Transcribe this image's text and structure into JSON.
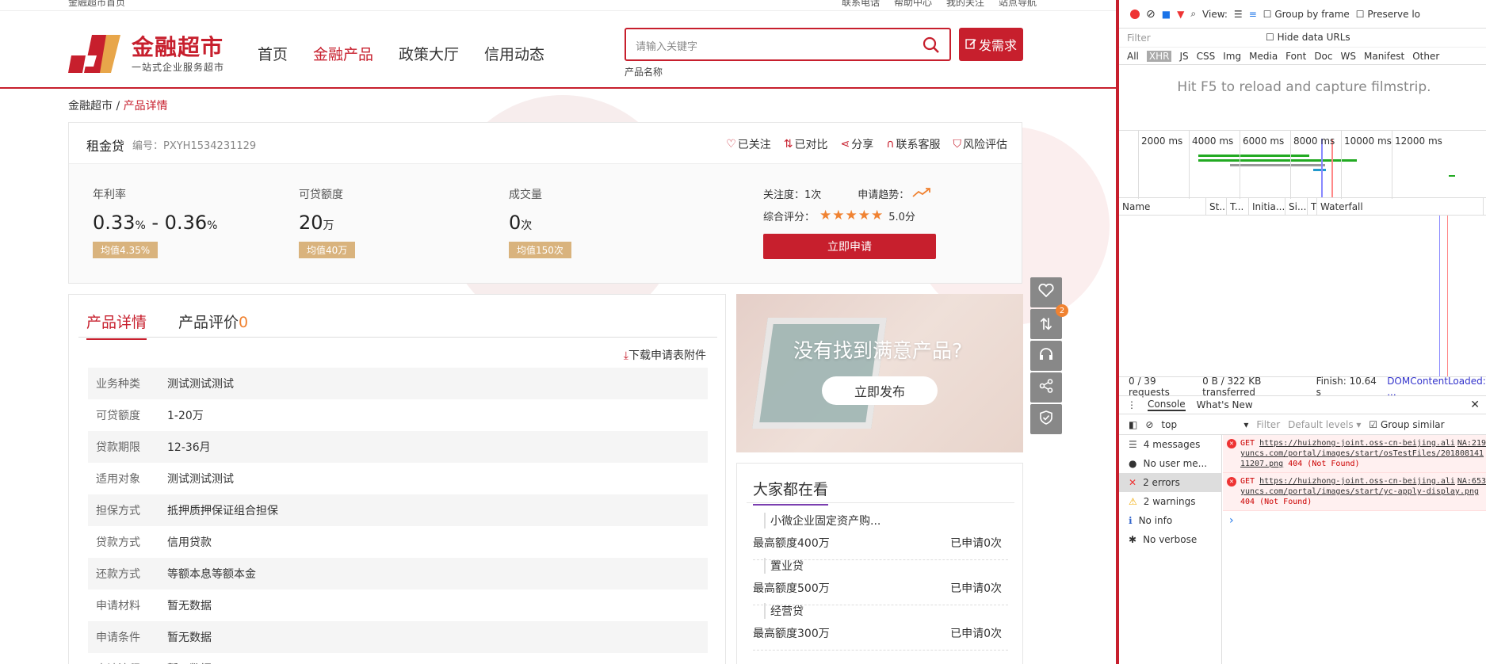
{
  "topbar": {
    "left": "金融超市首页",
    "links": [
      "联系电话",
      "帮助中心",
      "我的关注",
      "站点导航"
    ]
  },
  "header": {
    "logo_name": "金融超市",
    "logo_sub": "一站式企业服务超市",
    "nav": [
      "首页",
      "金融产品",
      "政策大厅",
      "信用动态"
    ],
    "active_nav": "金融产品",
    "search_placeholder": "请输入关键字",
    "search_hint": "产品名称",
    "publish_label": "发需求"
  },
  "breadcrumb": {
    "home": "金融超市",
    "sep": " / ",
    "current": "产品详情"
  },
  "product": {
    "name": "租金贷",
    "code": "编号：PXYH1534231129",
    "actions": [
      "已关注",
      "已对比",
      "分享",
      "联系客服",
      "风险评估"
    ],
    "stats": [
      {
        "label": "年利率",
        "value": "0.33",
        "unit": "%",
        "value2": "0.36",
        "unit2": "%",
        "avg": "均值4.35%"
      },
      {
        "label": "可贷额度",
        "value": "20",
        "unit": "万",
        "avg": "均值40万"
      },
      {
        "label": "成交量",
        "value": "0",
        "unit": "次",
        "avg": "均值150次"
      }
    ],
    "attention": "关注度：1次",
    "trend_label": "申请趋势：",
    "rating_label": "综合评分：",
    "rating": 5,
    "rating_text": "5.0分",
    "apply_label": "立即申请"
  },
  "detail": {
    "tabs": [
      "产品详情",
      "产品评价"
    ],
    "review_count": "0",
    "download": "下载申请表附件",
    "rows": [
      {
        "k": "业务种类",
        "v": "测试测试测试"
      },
      {
        "k": "可贷额度",
        "v": "1-20万"
      },
      {
        "k": "贷款期限",
        "v": "12-36月"
      },
      {
        "k": "适用对象",
        "v": "测试测试测试"
      },
      {
        "k": "担保方式",
        "v": "抵押质押保证组合担保"
      },
      {
        "k": "贷款方式",
        "v": "信用贷款"
      },
      {
        "k": "还款方式",
        "v": "等额本息等额本金"
      },
      {
        "k": "申请材料",
        "v": "暂无数据"
      },
      {
        "k": "申请条件",
        "v": "暂无数据"
      },
      {
        "k": "申请流程",
        "v": "暂无数据"
      }
    ]
  },
  "ad": {
    "title": "没有找到满意产品?",
    "button": "立即发布"
  },
  "popular": {
    "title": "大家都在看",
    "items": [
      {
        "name": "小微企业固定资产购...",
        "amount": "最高额度400万",
        "count": "已申请0次"
      },
      {
        "name": "置业贷",
        "amount": "最高额度500万",
        "count": "已申请0次"
      },
      {
        "name": "经营贷",
        "amount": "最高额度300万",
        "count": "已申请0次"
      }
    ]
  },
  "float": {
    "compare_badge": "2"
  },
  "devtools": {
    "view_label": "View:",
    "group_by_frame": "Group by frame",
    "preserve_log": "Preserve lo",
    "filter_placeholder": "Filter",
    "hide_data_urls": "Hide data URLs",
    "types": [
      "All",
      "XHR",
      "JS",
      "CSS",
      "Img",
      "Media",
      "Font",
      "Doc",
      "WS",
      "Manifest",
      "Other"
    ],
    "selected_type": "XHR",
    "reload_msg": "Hit F5 to reload and capture filmstrip.",
    "ticks": [
      "2000 ms",
      "4000 ms",
      "6000 ms",
      "8000 ms",
      "10000 ms",
      "12000 ms"
    ],
    "columns": [
      "Name",
      "St...",
      "T...",
      "Initia...",
      "Si...",
      "T",
      "Waterfall"
    ],
    "status": {
      "requests": "0 / 39 requests",
      "transferred": "0 B / 322 KB transferred",
      "finish": "Finish: 10.64 s",
      "dcl": "DOMContentLoaded: ..."
    },
    "console_tabs": [
      "Console",
      "What's New"
    ],
    "context": "top",
    "filter_label": "Filter",
    "levels": "Default levels",
    "group_similar": "Group similar",
    "sidebar": [
      "4 messages",
      "No user me...",
      "2 errors",
      "2 warnings",
      "No info",
      "No verbose"
    ],
    "errors": [
      {
        "method": "GET",
        "url": "https://huizhong-joint.oss-cn-beijing.aliyuncs.com/portal/images/start/osTestFiles/20180814111207.png",
        "src": "NA:219",
        "status": "404 (Not Found)"
      },
      {
        "method": "GET",
        "url": "https://huizhong-joint.oss-cn-beijing.aliyuncs.com/portal/images/start/yc-apply-display.png",
        "src": "NA:653",
        "status": "404 (Not Found)"
      }
    ]
  },
  "colors": {
    "brand": "#c71f2d",
    "gold": "#d9b37d",
    "orange": "#f08231"
  }
}
